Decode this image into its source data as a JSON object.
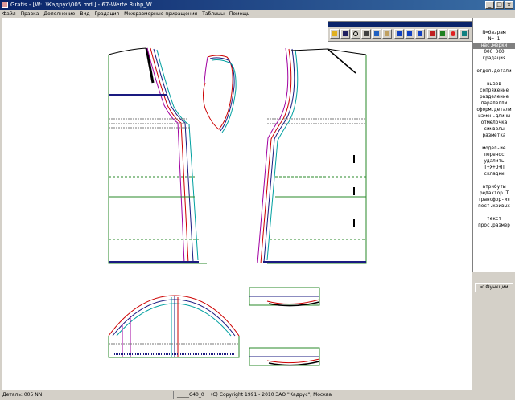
{
  "window": {
    "title": "Grafis - [W:..\\Кадрус\\005.mdl] - 67-Werte Ruhp_W",
    "min": "_",
    "max": "□",
    "close": "×"
  },
  "menu": [
    "Файл",
    "Правка",
    "Дополнение",
    "Вид",
    "Градация",
    "Межразмерные приращения",
    "Таблицы",
    "Помощь"
  ],
  "toolbar": {
    "buttons": [
      "open-icon",
      "save-icon",
      "zoom-icon",
      "print-icon",
      "layout-icon",
      "ruler-icon",
      "g-icon",
      "x-icon",
      "z-icon",
      "export-icon",
      "import-icon",
      "stop-icon",
      "grid-icon"
    ],
    "accent": "#0a246a"
  },
  "panel": {
    "header": [
      "N=базрам",
      "N=    1"
    ],
    "selected": "нас.мерки",
    "values": [
      "000  000"
    ],
    "grading": "градация",
    "groups": [
      [
        "отдел.детали"
      ],
      [
        "вызов",
        "сопряжение",
        "разделение",
        "паралелли",
        "оформ.детали",
        "измен.длины",
        "отмелочка",
        "символы",
        "разметка"
      ],
      [
        "модел-ие",
        "перенос",
        "удалить",
        "Т+Х+О+П",
        "складки"
      ],
      [
        "атрибуты",
        "редактор Т",
        "трансфор-ия",
        "пост.кривых"
      ],
      [
        "текст",
        "прос.размер"
      ]
    ],
    "functions_button": "< Функции"
  },
  "status": {
    "left": "Деталь: 005   NN",
    "mid": "_____C40_0",
    "right": "(C) Copyright 1991 - 2010 ЗАО \"Кадрус\", Москва"
  }
}
